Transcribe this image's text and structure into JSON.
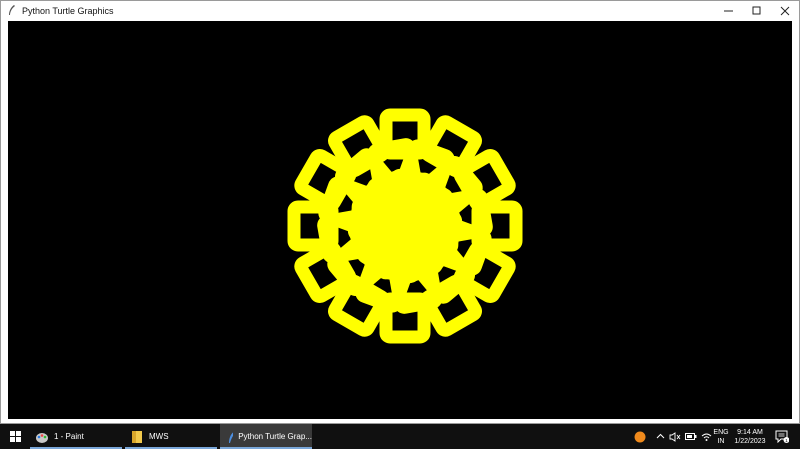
{
  "window": {
    "title": "Python Turtle Graphics",
    "controls": [
      "minimize",
      "maximize",
      "close"
    ]
  },
  "canvas": {
    "background": "#000000",
    "drawing_color": "#ffff00",
    "drawing": "yellow-square-flower-pattern"
  },
  "taskbar": {
    "items": [
      {
        "label": "1 - Paint",
        "icon": "paint-icon"
      },
      {
        "label": "MWS",
        "icon": "folder-icon"
      },
      {
        "label": "Python Turtle Grap...",
        "icon": "python-turtle-icon"
      }
    ],
    "tray": {
      "language": "ENG",
      "region": "IN",
      "time": "9:14 AM",
      "date": "1/22/2023",
      "notification_count": "1"
    }
  }
}
